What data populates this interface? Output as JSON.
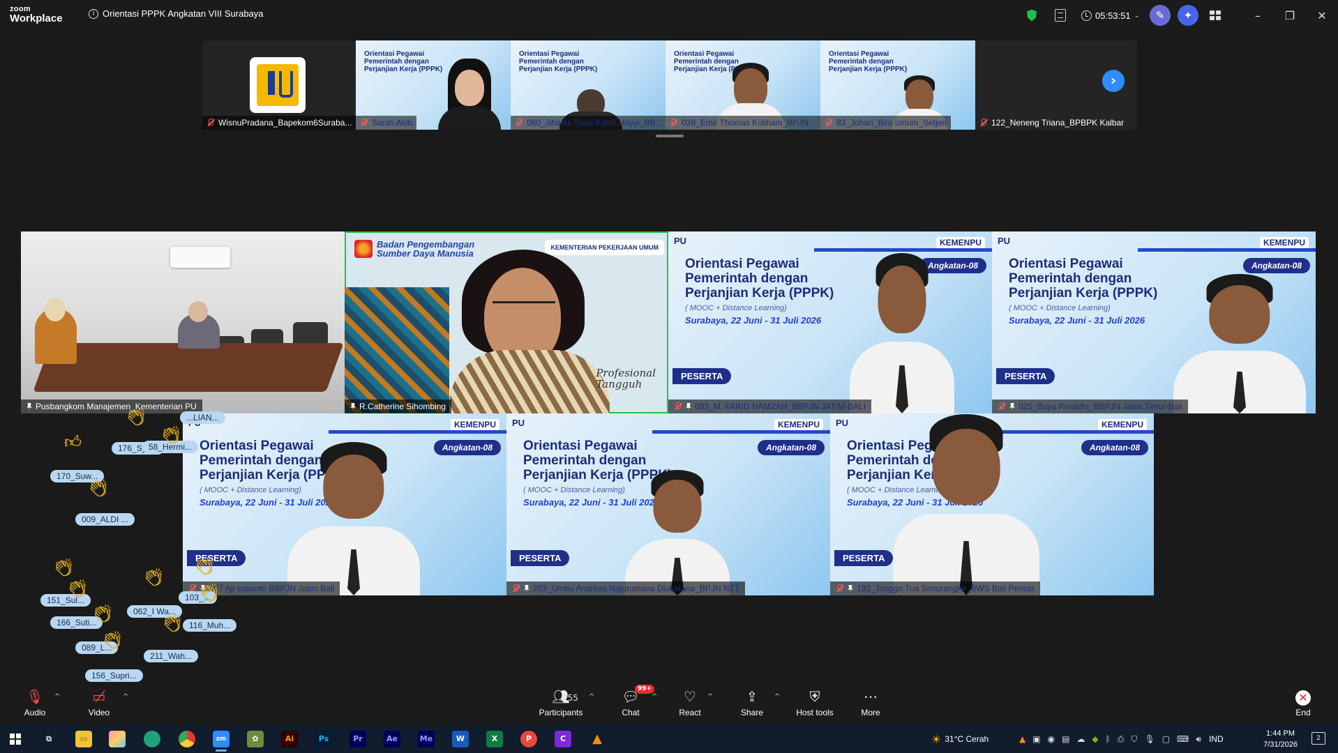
{
  "window": {
    "logo_line1": "zoom",
    "logo_line2": "Workplace",
    "meeting_title": "Orientasi PPPK Angkatan VIII Surabaya",
    "timer": "05:53:51"
  },
  "thumbnails": [
    {
      "name": "WisnuPradana_Bapekom6Suraba...",
      "type": "logo"
    },
    {
      "name": "Sarah Akib",
      "type": "slide"
    },
    {
      "name": "080_Jihadis Tsani Kahfil Hayyi_BB...",
      "type": "slide"
    },
    {
      "name": "039_Emir Thomas Koliham_BPJN ...",
      "type": "slide"
    },
    {
      "name": "83_Johari_Biro umum_Setjen",
      "type": "slide"
    },
    {
      "name": "122_Neneng Triana_BPBPK Kalbar",
      "type": "dark"
    }
  ],
  "slide_text": {
    "pu": "PU",
    "kemenpu": "KEMENPU",
    "angkatan": "Angkatan-08",
    "heading_l1": "Orientasi Pegawai",
    "heading_l2": "Pemerintah dengan",
    "heading_l3": "Perjanjian Kerja (PPPK)",
    "sub": "( MOOC + Distance Learning)",
    "place": "Surabaya, 22 Juni - 31 Juli 2026",
    "peserta": "PESERTA"
  },
  "presenter_slide": {
    "brand_l1": "Badan Pengembangan",
    "brand_l2": "Sumber Daya Manusia",
    "kementerian": "KEMENTERIAN PEKERJAAN UMUM",
    "script_l1": "Profesional",
    "script_l2": "Tangguh"
  },
  "tiles": [
    {
      "name": "Pusbangkom Manajemen_Kementerian PU",
      "mic": "on",
      "active": false
    },
    {
      "name": "R.Catherine Sihombing",
      "mic": "on",
      "active": true
    },
    {
      "name": "093_M. FARID HAMZAH_BBPJN JATIM-BALI",
      "mic": "off",
      "active": false
    },
    {
      "name": "025_Bayu Rinaldhi_BBPJN Jawa Timur-Bali",
      "mic": "off",
      "active": false
    },
    {
      "name": "007 Aji supanto BBPJN Jatim Bali",
      "mic": "off",
      "active": false
    },
    {
      "name": "203_Umbu Andreas Ndjurumana Djukatana_BPJN NTT",
      "mic": "off",
      "active": false
    },
    {
      "name": "192_Tonggo Tua Simorangkir_BWS Bali Penida",
      "mic": "off",
      "active": false
    }
  ],
  "reactions": [
    "176_Sya...",
    "58_Hermi...",
    "170_Suw...",
    "009_ALDI ...",
    "151_Sul...",
    "062_I Wa...",
    "103_...",
    "166_Suti...",
    "116_Muh...",
    "089_L...",
    "211_Wah...",
    "156_Supri...",
    "...LIAN..."
  ],
  "toolbar": {
    "audio": "Audio",
    "video": "Video",
    "participants": "Participants",
    "participants_count": "255",
    "chat": "Chat",
    "chat_badge": "99+",
    "react": "React",
    "share": "Share",
    "host_tools": "Host tools",
    "more": "More",
    "end": "End"
  },
  "taskbar": {
    "weather": "31°C  Cerah",
    "lang": "IND",
    "time": "1:44 PM",
    "date": "7/31/2026",
    "notif_count": "2"
  }
}
